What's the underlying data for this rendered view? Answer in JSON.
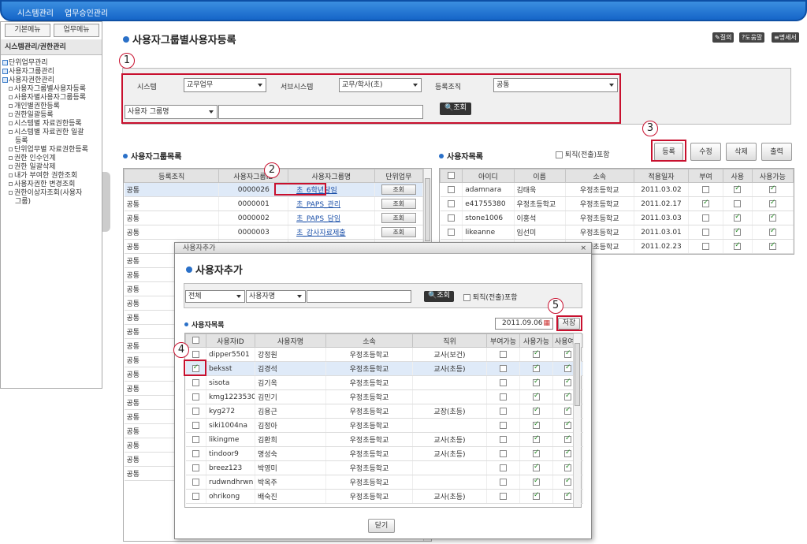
{
  "topbar": {
    "menu1": "시스템관리",
    "menu2": "업무승인관리"
  },
  "left": {
    "tab1": "기본메뉴",
    "tab2": "업무메뉴",
    "header": "시스템관리/권한관리",
    "groups": [
      "단위업무관리",
      "사용자그룹관리",
      "사용자권한관리"
    ],
    "items": [
      "사용자그룹별사용자등록",
      "사용자별사용자그룹등록",
      "개인별권한등록",
      "권한일괄등록",
      "시스템별 자료권한등록",
      "시스템별 자료권한 일괄",
      "등록",
      "단위업무별 자료권한등록",
      "권한 인수인계",
      "권한 일괄삭제",
      "내가 부여한 권한조회",
      "사용자권한 변경조회",
      "권한이상자조회(사용자",
      "그룹)"
    ]
  },
  "page": {
    "title": "사용자그룹별사용자등록",
    "btn_q": "질의",
    "btn_help": "도움말",
    "btn_print": "명세서"
  },
  "search": {
    "system_label": "시스템",
    "system_value": "교무업무",
    "subsystem_label": "서브시스템",
    "subsystem_value": "교무/학사(초)",
    "org_label": "등록조직",
    "org_value": "공통",
    "group_sel": "사용자 그룹명",
    "btn": "조회"
  },
  "markers": {
    "m1": "1",
    "m2": "2",
    "m3": "3",
    "m4": "4",
    "m5": "5"
  },
  "groupList": {
    "title": "사용자그룹목록",
    "headers": [
      "등록조직",
      "사용자그룹ID",
      "사용자그룹명",
      "단위업무"
    ],
    "rows": [
      [
        "공통",
        "0000026",
        "초_6학년담임",
        "조회"
      ],
      [
        "공통",
        "0000001",
        "초_PAPS_관리",
        "조회"
      ],
      [
        "공통",
        "0000002",
        "초_PAPS_담임",
        "조회"
      ],
      [
        "공통",
        "0000003",
        "초_감사자료제출",
        "조회"
      ],
      [
        "공통",
        "",
        "",
        ""
      ],
      [
        "공통",
        "",
        "",
        ""
      ],
      [
        "공통",
        "",
        "",
        ""
      ],
      [
        "공통",
        "",
        "",
        ""
      ],
      [
        "공통",
        "",
        "",
        ""
      ],
      [
        "공통",
        "",
        "",
        ""
      ],
      [
        "공통",
        "",
        "",
        ""
      ],
      [
        "공통",
        "",
        "",
        ""
      ],
      [
        "공통",
        "",
        "",
        ""
      ],
      [
        "공통",
        "",
        "",
        ""
      ],
      [
        "공통",
        "",
        "",
        ""
      ],
      [
        "공통",
        "",
        "",
        ""
      ],
      [
        "공통",
        "",
        "",
        ""
      ],
      [
        "공통",
        "",
        "",
        ""
      ],
      [
        "공통",
        "",
        "",
        ""
      ],
      [
        "공통",
        "",
        "",
        ""
      ],
      [
        "공통",
        "",
        "",
        ""
      ]
    ]
  },
  "userList": {
    "title": "사용자목록",
    "retired": "퇴직(전출)포함",
    "btns": [
      "등록",
      "수정",
      "삭제",
      "출력"
    ],
    "headers": [
      "아이디",
      "이름",
      "소속",
      "적용일자",
      "부여",
      "사용",
      "사용가능"
    ],
    "rows": [
      {
        "id": "adamnara",
        "name": "김태욱",
        "org": "우정초등학교",
        "date": "2011.03.02",
        "g": false,
        "u": true,
        "a": true
      },
      {
        "id": "e41755380",
        "name": "우정초등학교",
        "org": "우정초등학교",
        "date": "2011.02.17",
        "g": true,
        "u": false,
        "a": true
      },
      {
        "id": "stone1006",
        "name": "이홍석",
        "org": "우정초등학교",
        "date": "2011.03.03",
        "g": false,
        "u": true,
        "a": true
      },
      {
        "id": "likeanne",
        "name": "임선미",
        "org": "우정초등학교",
        "date": "2011.03.01",
        "g": false,
        "u": true,
        "a": true
      },
      {
        "id": "",
        "name": "",
        "org": "우정초등학교",
        "date": "2011.02.23",
        "g": false,
        "u": true,
        "a": true
      }
    ]
  },
  "modal": {
    "bar": "사용자추가",
    "title": "사용자추가",
    "sel1": "전체",
    "sel2": "사용자명",
    "btn": "조회",
    "retired": "퇴직(전출)포함",
    "listTitle": "사용자목록",
    "date": "2011.09.06",
    "save": "저장",
    "close": "닫기",
    "headers": [
      "사용자ID",
      "사용자명",
      "소속",
      "직위",
      "부여가능",
      "사용가능",
      "사용여부"
    ],
    "rows": [
      {
        "id": "dipper5501",
        "name": "강정원",
        "org": "우정초등학교",
        "pos": "교사(보건)",
        "chk": false
      },
      {
        "id": "beksst",
        "name": "김경석",
        "org": "우정초등학교",
        "pos": "교사(초등)",
        "chk": true
      },
      {
        "id": "sisota",
        "name": "김기옥",
        "org": "우정초등학교",
        "pos": "",
        "chk": false
      },
      {
        "id": "kmg1223530",
        "name": "김민기",
        "org": "우정초등학교",
        "pos": "",
        "chk": false
      },
      {
        "id": "kyg272",
        "name": "김용근",
        "org": "우정초등학교",
        "pos": "교장(초등)",
        "chk": false
      },
      {
        "id": "siki1004na",
        "name": "김정아",
        "org": "우정초등학교",
        "pos": "",
        "chk": false
      },
      {
        "id": "likingme",
        "name": "김환희",
        "org": "우정초등학교",
        "pos": "교사(초등)",
        "chk": false
      },
      {
        "id": "tindoor9",
        "name": "명성숙",
        "org": "우정초등학교",
        "pos": "교사(초등)",
        "chk": false
      },
      {
        "id": "breez123",
        "name": "박영미",
        "org": "우정초등학교",
        "pos": "",
        "chk": false
      },
      {
        "id": "rudwndhrwn",
        "name": "박옥주",
        "org": "우정초등학교",
        "pos": "",
        "chk": false
      },
      {
        "id": "ohrikong",
        "name": "배숙진",
        "org": "우정초등학교",
        "pos": "교사(초등)",
        "chk": false
      }
    ]
  },
  "colors": {
    "accent": "#1565c8",
    "marker": "#c8102e"
  }
}
